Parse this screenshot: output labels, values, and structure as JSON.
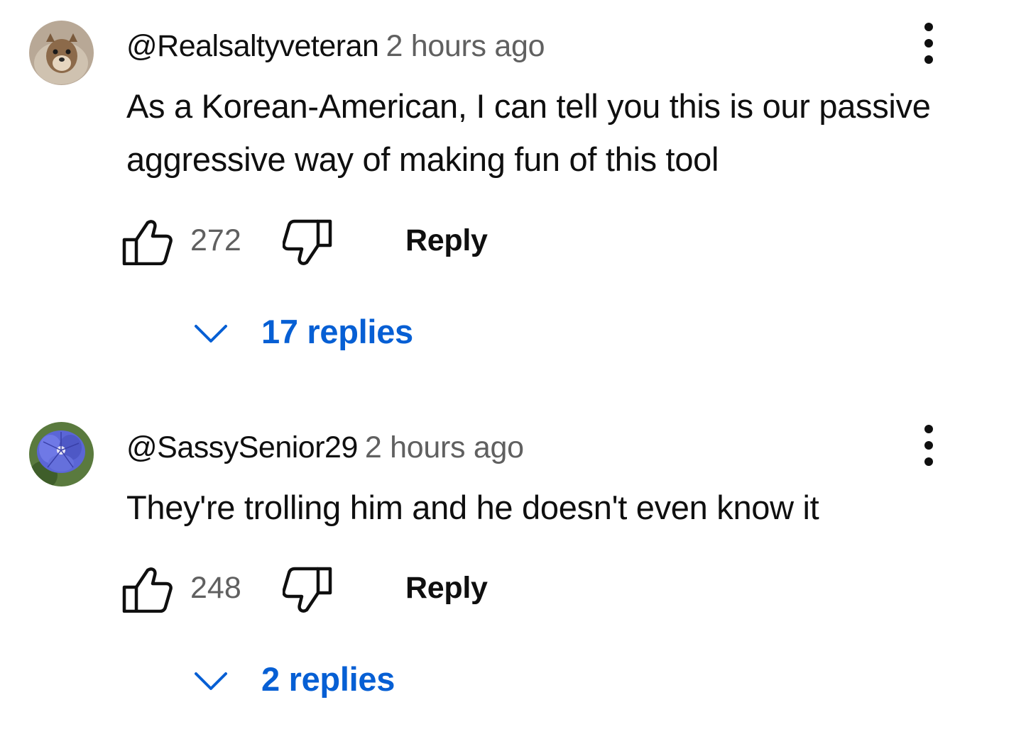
{
  "comments": [
    {
      "author": "@Realsaltyveteran",
      "time": "2 hours ago",
      "text": "As a Korean-American, I can tell you this is our passive aggressive way of making fun of this tool",
      "likes": "272",
      "reply_label": "Reply",
      "replies_label": "17 replies"
    },
    {
      "author": "@SassySenior29",
      "time": "2 hours ago",
      "text": "They're trolling him and he doesn't even know it",
      "likes": "248",
      "reply_label": "Reply",
      "replies_label": "2 replies"
    }
  ],
  "icons": {
    "like": "thumbs-up-outline-icon",
    "dislike": "thumbs-down-outline-icon",
    "menu": "vertical-ellipsis-icon",
    "expand": "chevron-down-icon"
  },
  "colors": {
    "replies_link": "#065fd4",
    "secondary_text": "#606060",
    "primary_text": "#0f0f0f"
  }
}
